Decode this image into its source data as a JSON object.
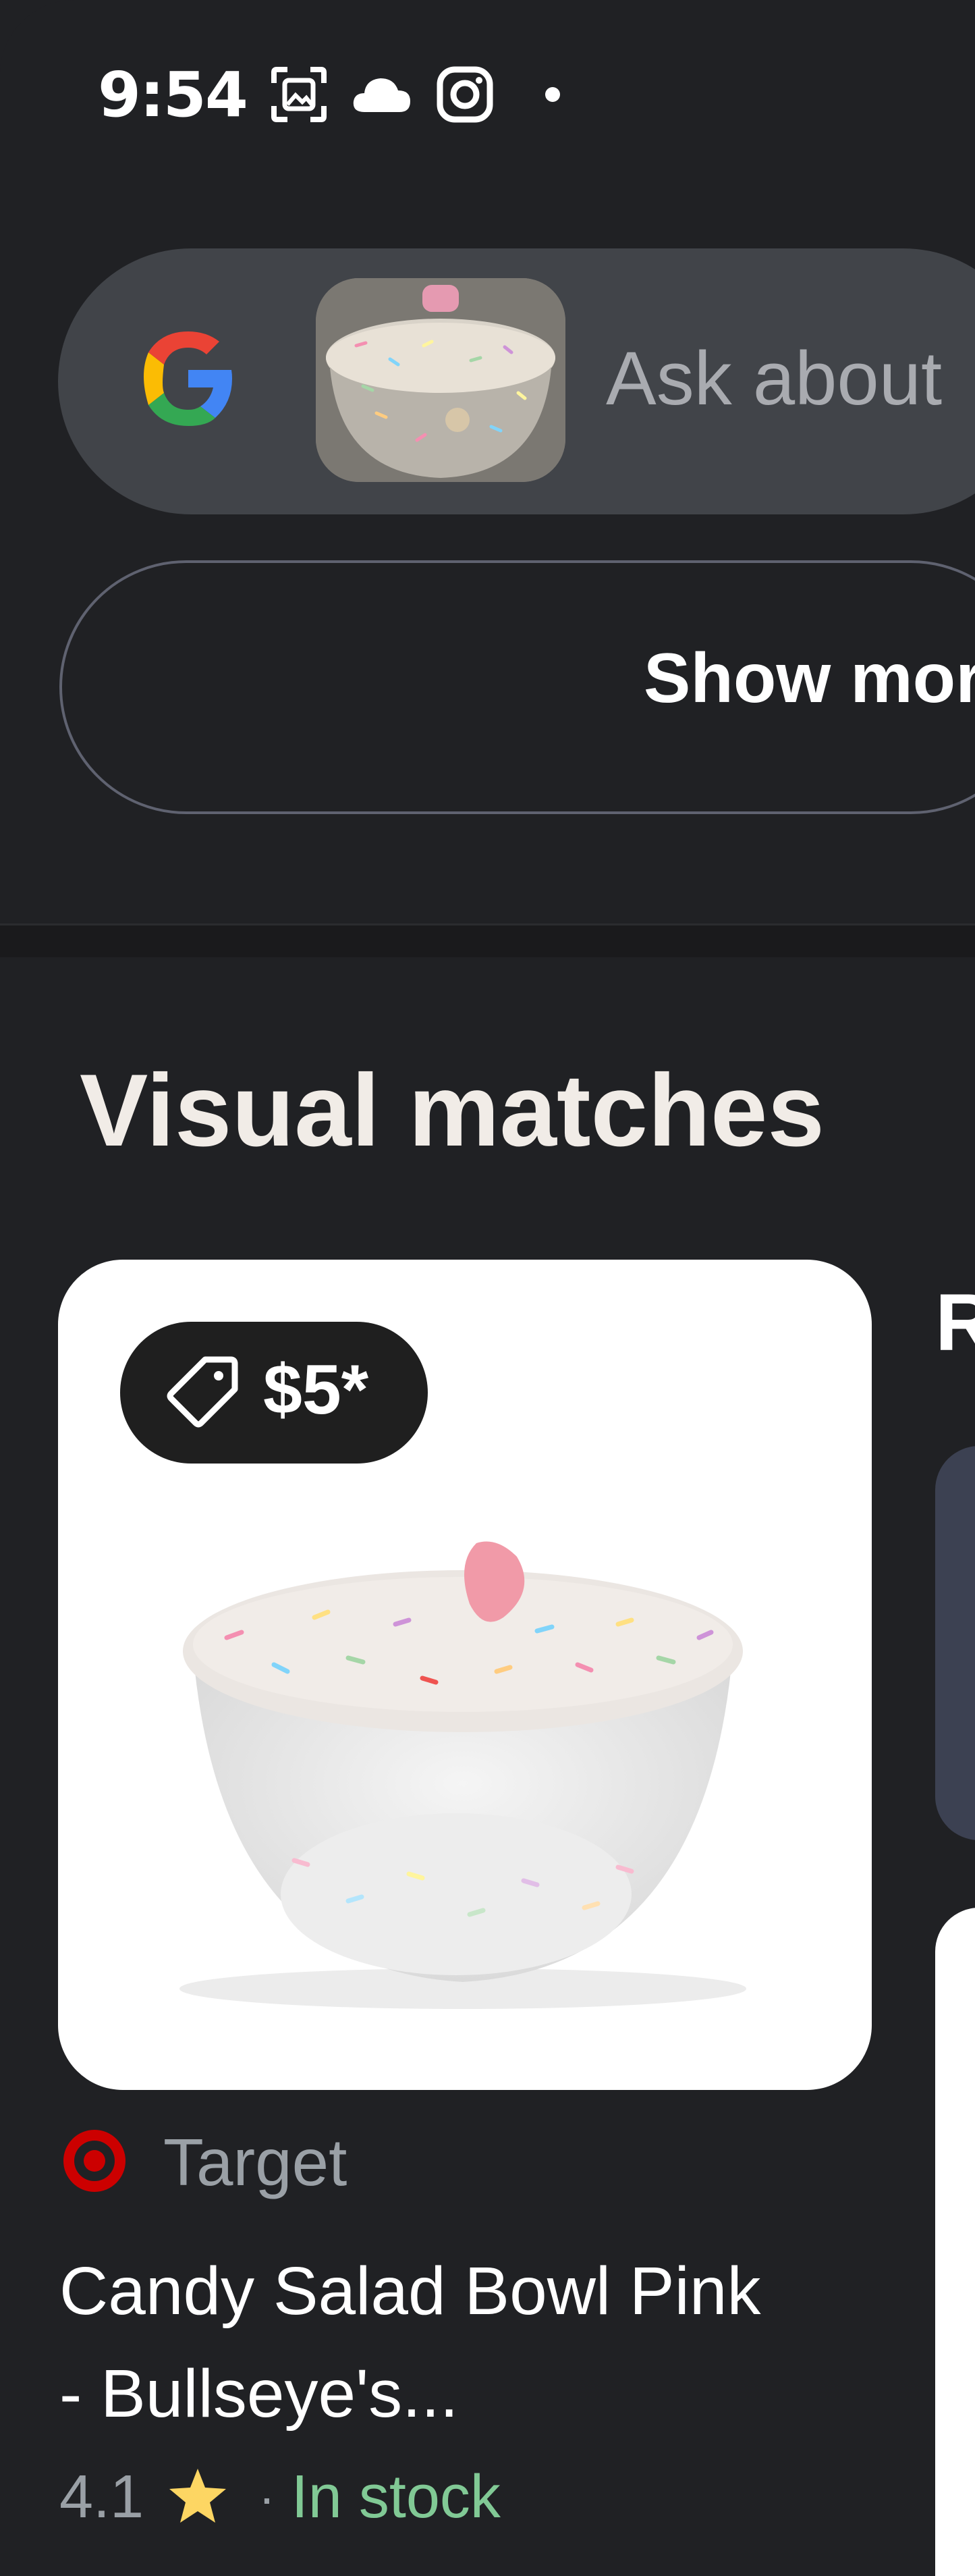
{
  "status_bar": {
    "time": "9:54",
    "icons": [
      "screenshot-icon",
      "cloud-icon",
      "instagram-icon",
      "notification-dot-icon"
    ]
  },
  "search": {
    "placeholder": "Ask about",
    "logo_icon": "google-g-icon",
    "thumbnail": "bowl-thumbnail"
  },
  "show_more": {
    "label": "Show mor"
  },
  "visual_matches": {
    "title": "Visual matches",
    "next_card_peek_letter": "R"
  },
  "product": {
    "price": "$5*",
    "price_icon": "tag-icon",
    "merchant": "Target",
    "merchant_icon": "target-logo-icon",
    "title_line1": "Candy Salad Bowl Pink",
    "title_line2": "- Bullseye's...",
    "rating": "4.1",
    "rating_icon": "star-icon",
    "separator": "·",
    "availability": "In stock"
  },
  "colors": {
    "background": "#202124",
    "search_pill": "#414449",
    "in_stock": "#81c995",
    "star": "#fdd663",
    "target_red": "#cc0000"
  }
}
